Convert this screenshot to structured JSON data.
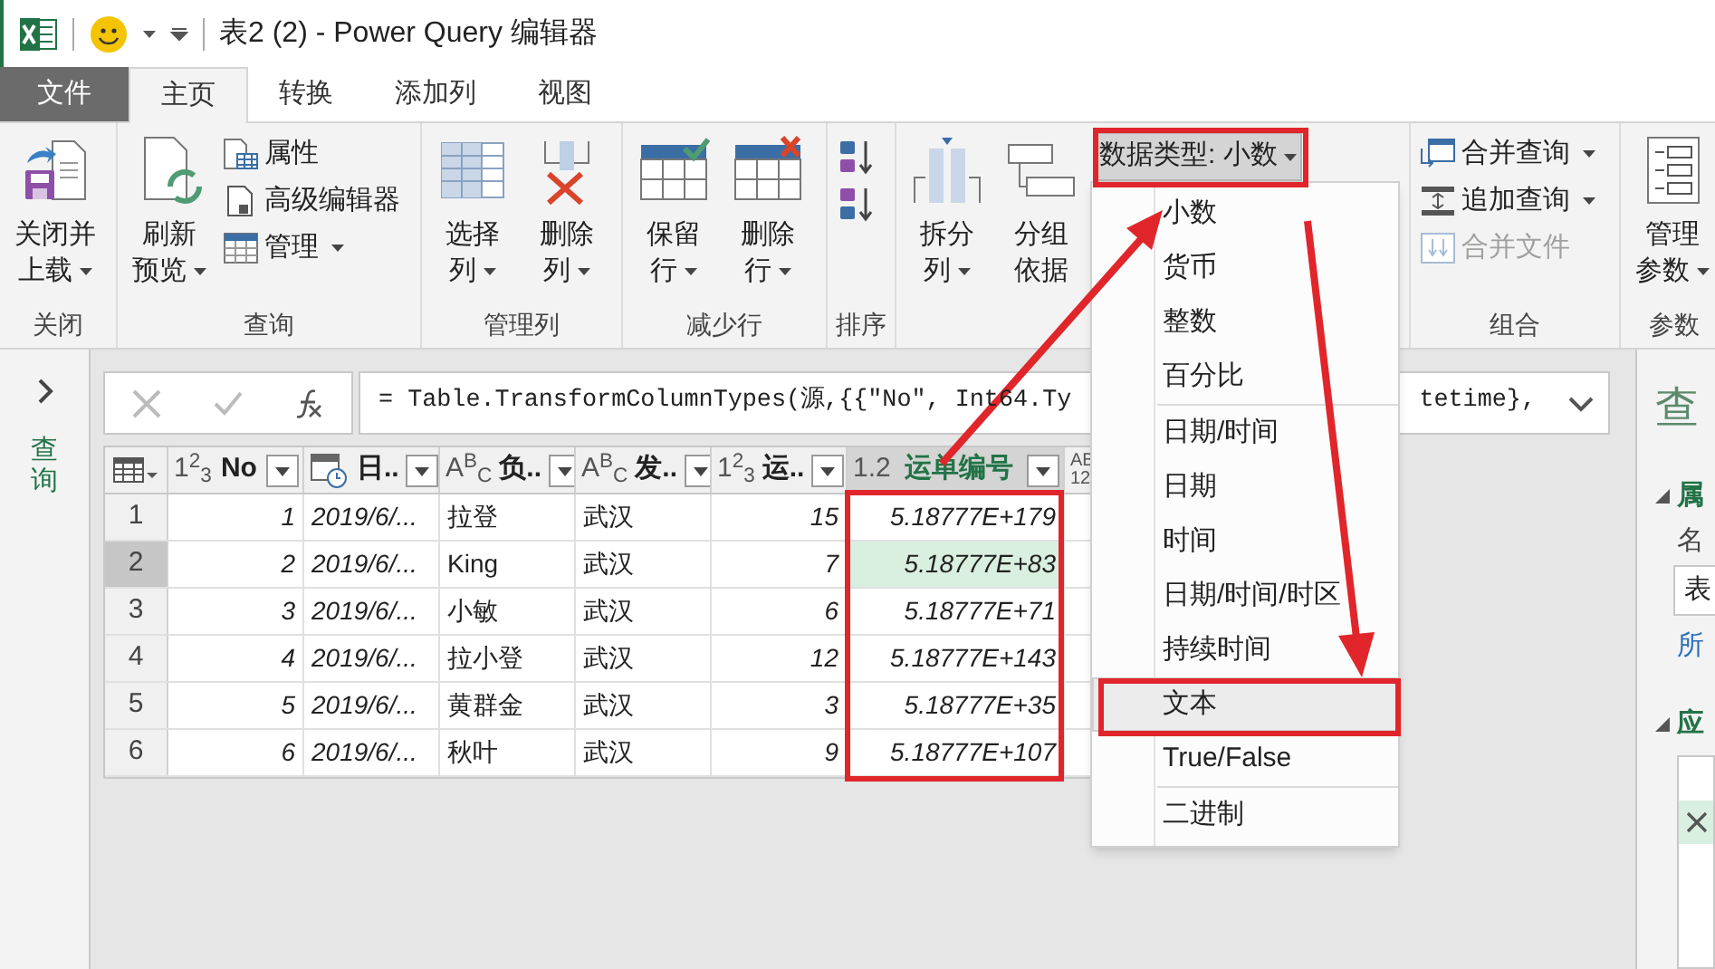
{
  "window": {
    "title": "表2 (2) - Power Query 编辑器"
  },
  "tabs": [
    {
      "label": "文件",
      "kind": "file",
      "selected": false
    },
    {
      "label": "主页",
      "kind": "tab",
      "selected": true
    },
    {
      "label": "转换",
      "kind": "tab",
      "selected": false
    },
    {
      "label": "添加列",
      "kind": "tab",
      "selected": false
    },
    {
      "label": "视图",
      "kind": "tab",
      "selected": false
    }
  ],
  "ribbon_groups": [
    {
      "label": "关闭",
      "items": [
        {
          "kind": "large",
          "lines": [
            "关闭并",
            "上载"
          ],
          "dropdown": true
        }
      ]
    },
    {
      "label": "查询",
      "items": [
        {
          "kind": "large",
          "lines": [
            "刷新",
            "预览"
          ],
          "dropdown": true
        },
        {
          "kind": "stack",
          "items": [
            {
              "label": "属性",
              "dropdown": false,
              "disabled": false
            },
            {
              "label": "高级编辑器",
              "dropdown": false,
              "disabled": false
            },
            {
              "label": "管理",
              "dropdown": true,
              "disabled": false
            }
          ]
        }
      ]
    },
    {
      "label": "管理列",
      "items": [
        {
          "kind": "large",
          "lines": [
            "选择",
            "列"
          ],
          "dropdown": true
        },
        {
          "kind": "large",
          "lines": [
            "删除",
            "列"
          ],
          "dropdown": true
        }
      ]
    },
    {
      "label": "减少行",
      "items": [
        {
          "kind": "large",
          "lines": [
            "保留",
            "行"
          ],
          "dropdown": true
        },
        {
          "kind": "large",
          "lines": [
            "删除",
            "行"
          ],
          "dropdown": true
        }
      ]
    },
    {
      "label": "排序",
      "items": [
        {
          "kind": "sort"
        }
      ]
    },
    {
      "items": [
        {
          "kind": "large",
          "lines": [
            "拆分",
            "列"
          ],
          "dropdown": true
        },
        {
          "kind": "large",
          "lines": [
            "分组",
            "依据"
          ],
          "dropdown": false
        },
        {
          "kind": "datatype",
          "label": "数据类型: 小数",
          "dropdown": true,
          "expanded": true
        }
      ]
    },
    {
      "label": "组合",
      "items": [
        {
          "kind": "stack",
          "items": [
            {
              "label": "合并查询",
              "dropdown": true,
              "disabled": false
            },
            {
              "label": "追加查询",
              "dropdown": true,
              "disabled": false
            },
            {
              "label": "合并文件",
              "dropdown": false,
              "disabled": true
            }
          ]
        }
      ]
    },
    {
      "label": "参数",
      "items": [
        {
          "kind": "large",
          "lines": [
            "管理",
            "参数"
          ],
          "dropdown": true
        }
      ]
    }
  ],
  "type_menu": {
    "items": [
      {
        "label": "小数",
        "highlighted": false,
        "separator_before": false
      },
      {
        "label": "货币",
        "highlighted": false,
        "separator_before": false
      },
      {
        "label": "整数",
        "highlighted": false,
        "separator_before": false
      },
      {
        "label": "百分比",
        "highlighted": false,
        "separator_before": false
      },
      {
        "label": "日期/时间",
        "highlighted": false,
        "separator_before": true
      },
      {
        "label": "日期",
        "highlighted": false,
        "separator_before": false
      },
      {
        "label": "时间",
        "highlighted": false,
        "separator_before": false
      },
      {
        "label": "日期/时间/时区",
        "highlighted": false,
        "separator_before": false
      },
      {
        "label": "持续时间",
        "highlighted": false,
        "separator_before": false
      },
      {
        "label": "文本",
        "highlighted": true,
        "separator_before": false
      },
      {
        "label": "True/False",
        "highlighted": false,
        "separator_before": false
      },
      {
        "label": "二进制",
        "highlighted": false,
        "separator_before": true
      }
    ]
  },
  "sidebar": {
    "label": "查询",
    "collapsed": true
  },
  "formula_bar": {
    "start": "= Table.TransformColumnTypes(源,{{\"No\", Int64.Ty",
    "end": "tetime},"
  },
  "table": {
    "columns": [
      {
        "kind": "whole",
        "type_label": "1$^{2}$$_{3}$",
        "name": "No",
        "selected": false
      },
      {
        "kind": "date",
        "name": "日..",
        "selected": false
      },
      {
        "kind": "text",
        "type_label": "A$^{B}$$_{C}$",
        "name": "负..",
        "selected": false
      },
      {
        "kind": "text",
        "type_label": "A$^{B}$$_{C}$",
        "name": "发..",
        "selected": false
      },
      {
        "kind": "whole",
        "type_label": "1$^{2}$$_{3}$",
        "name": "运..",
        "selected": false
      },
      {
        "kind": "decimal",
        "type_label": "1.2",
        "name": "运单编号",
        "selected": true
      },
      {
        "kind": "any",
        "type_label": "AB 12",
        "selected": false
      }
    ],
    "rows": [
      {
        "n": "1",
        "selected": false,
        "cells": [
          "1",
          "2019/6/...",
          "拉登",
          "武汉",
          "15",
          "5.18777E+179"
        ]
      },
      {
        "n": "2",
        "selected": true,
        "cells": [
          "2",
          "2019/6/...",
          "King",
          "武汉",
          "7",
          "5.18777E+83"
        ]
      },
      {
        "n": "3",
        "selected": false,
        "cells": [
          "3",
          "2019/6/...",
          "小敏",
          "武汉",
          "6",
          "5.18777E+71"
        ]
      },
      {
        "n": "4",
        "selected": false,
        "cells": [
          "4",
          "2019/6/...",
          "拉小登",
          "武汉",
          "12",
          "5.18777E+143"
        ]
      },
      {
        "n": "5",
        "selected": false,
        "cells": [
          "5",
          "2019/6/...",
          "黄群金",
          "武汉",
          "3",
          "5.18777E+35"
        ]
      },
      {
        "n": "6",
        "selected": false,
        "cells": [
          "6",
          "2019/6/...",
          "秋叶",
          "武汉",
          "9",
          "5.18777E+107"
        ]
      }
    ]
  },
  "query_settings": {
    "title": "查",
    "properties": {
      "heading": "属",
      "expanded": true,
      "name_label": "名",
      "name_value": "表",
      "link": "所"
    },
    "steps": {
      "heading": "应",
      "expanded": true,
      "items": [
        {
          "selected": true
        }
      ]
    }
  }
}
